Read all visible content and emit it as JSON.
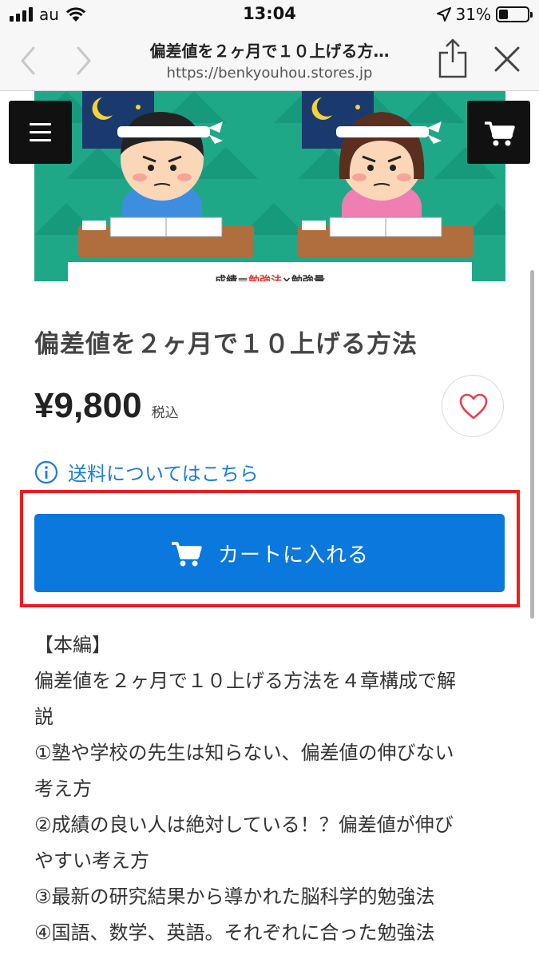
{
  "status_bar": {
    "carrier": "au",
    "time": "13:04",
    "battery_percent": "31%",
    "battery_level": 0.31
  },
  "browser": {
    "page_title": "偏差値を２ヶ月で１０上げる方…",
    "url": "https://benkyouhou.stores.jp"
  },
  "hero": {
    "caption_pre": "成績＝",
    "caption_accent": "勉強法",
    "caption_post": "×勉強量"
  },
  "product": {
    "title": "偏差値を２ヶ月で１０上げる方法",
    "price": "¥9,800",
    "tax_label": "税込",
    "shipping_link": "送料についてはこちら",
    "add_to_cart": "カートに入れる"
  },
  "description": {
    "lines": [
      "【本編】",
      "偏差値を２ヶ月で１０上げる方法を４章構成で解",
      "説",
      "①塾や学校の先生は知らない、偏差値の伸びない",
      "考え方",
      "②成績の良い人は絶対している！？偏差値が伸び",
      "やすい考え方",
      "③最新の研究結果から導かれた脳科学的勉強法",
      "④国語、数学、英語。それぞれに合った勉強法"
    ]
  },
  "colors": {
    "accent_blue": "#0a78dc",
    "link_blue": "#1a7ed6",
    "highlight_red": "#f01c1c",
    "hero_green": "#1fa888",
    "heart_red": "#e0454f"
  },
  "icons": {
    "menu": "hamburger-menu-icon",
    "cart": "cart-icon",
    "favorite": "heart-icon",
    "info": "info-icon",
    "share": "share-icon",
    "close": "close-icon",
    "back": "chevron-left-icon",
    "forward": "chevron-right-icon"
  }
}
